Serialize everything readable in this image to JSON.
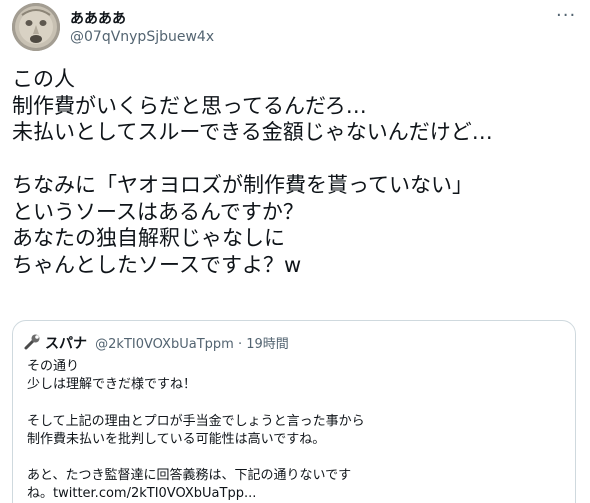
{
  "tweet": {
    "author": {
      "display_name": "ああああ",
      "handle": "@07qVnypSjbuew4x"
    },
    "more_icon": "more-dots-icon",
    "text_lines": [
      "この人",
      "制作費がいくらだと思ってるんだろ…",
      "未払いとしてスルーできる金額じゃないんだけど…",
      "",
      "ちなみに「ヤオヨロズが制作費を貰っていない」",
      "というソースはあるんですか？",
      "あなたの独自解釈じゃなしに",
      "ちゃんとしたソースですよ？w"
    ],
    "quoted": {
      "icon": "wrench-icon",
      "display_name": "スパナ",
      "handle": "@2kTI0VOXbUaTppm",
      "separator": "·",
      "time": "19時間",
      "text_lines": [
        "その通り",
        "少しは理解できだ様ですね！",
        "",
        "そして上記の理由とプロが手当金でしょうと言った事から",
        "制作費未払いを批判している可能性は高いですね。",
        "",
        "あと、たつき監督達に回答義務は、下記の通りないです",
        "ね。twitter.com/2kTI0VOXbUaTpp..."
      ]
    }
  }
}
